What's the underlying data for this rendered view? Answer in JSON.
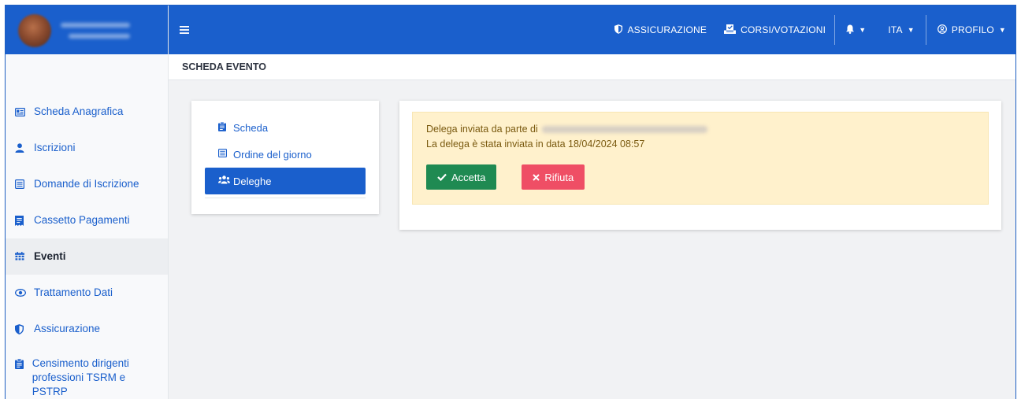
{
  "sidebar": {
    "items": [
      {
        "label": "Scheda Anagrafica",
        "icon": "id-card-icon"
      },
      {
        "label": "Iscrizioni",
        "icon": "user-icon"
      },
      {
        "label": "Domande di Iscrizione",
        "icon": "list-icon"
      },
      {
        "label": "Cassetto Pagamenti",
        "icon": "receipt-icon"
      },
      {
        "label": "Eventi",
        "icon": "calendar-icon",
        "active": true
      },
      {
        "label": "Trattamento Dati",
        "icon": "eye-icon"
      },
      {
        "label": "Assicurazione",
        "icon": "shield-icon"
      },
      {
        "label": "Censimento dirigenti professioni TSRM e PSTRP",
        "icon": "clipboard-icon"
      }
    ]
  },
  "topbar": {
    "insurance_label": "ASSICURAZIONE",
    "courses_label": "CORSI/VOTAZIONI",
    "language_label": "ITA",
    "profile_label": "PROFILO"
  },
  "breadcrumb": {
    "title": "SCHEDA EVENTO"
  },
  "event_tabs": [
    {
      "label": "Scheda",
      "icon": "clipboard-icon"
    },
    {
      "label": "Ordine del giorno",
      "icon": "list-icon"
    },
    {
      "label": "Deleghe",
      "icon": "users-icon",
      "active": true
    }
  ],
  "delegation": {
    "sent_by_label": "Delega inviata da parte di",
    "sent_date_text": "La delega è stata inviata in data 18/04/2024 08:57",
    "accept_label": "Accetta",
    "reject_label": "Rifiuta"
  },
  "colors": {
    "brand": "#1a5fcc",
    "accept": "#1f8a52",
    "reject": "#ef4e65",
    "alert_bg": "#fff1cc"
  }
}
